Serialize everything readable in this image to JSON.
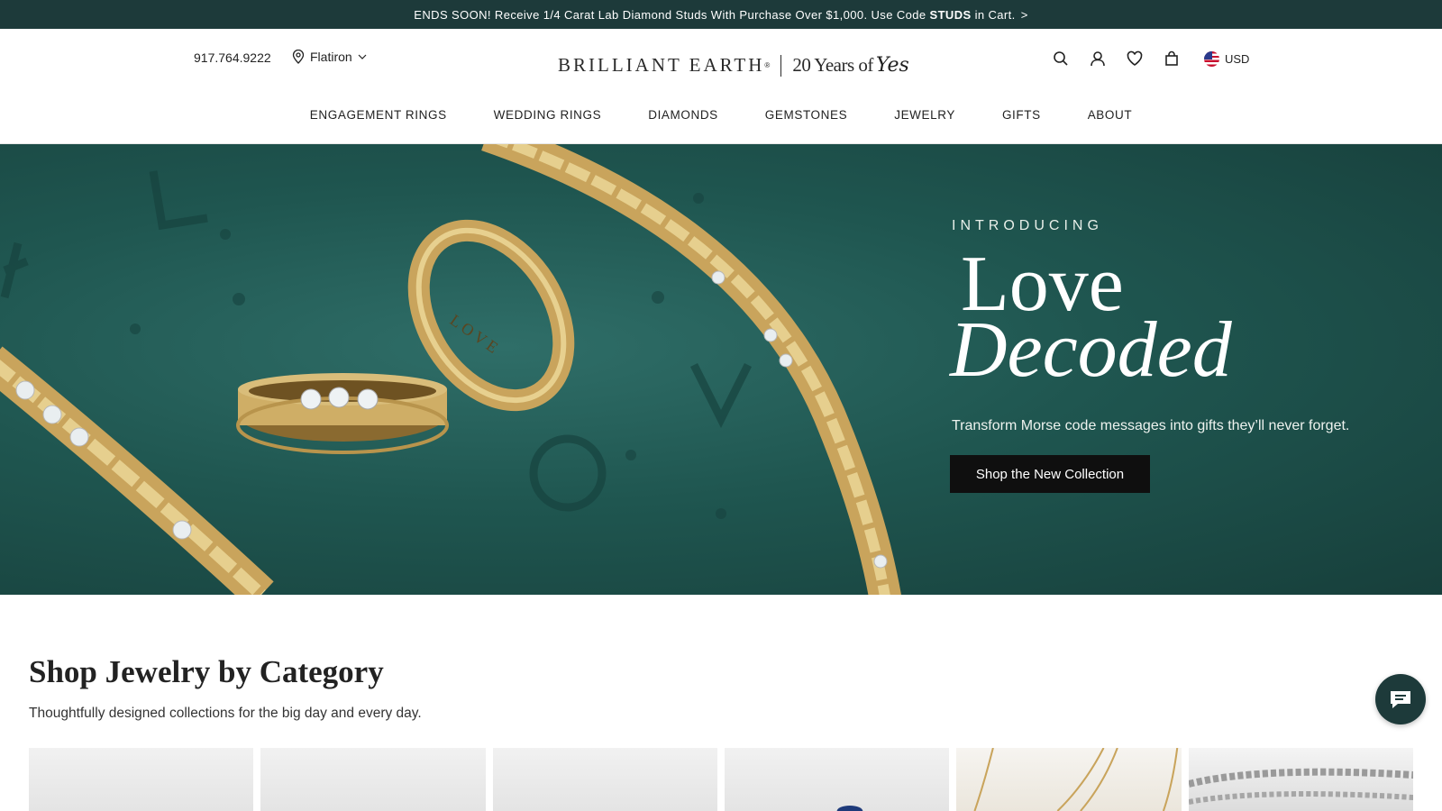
{
  "promo": {
    "text_before": "ENDS SOON! Receive 1/4 Carat Lab Diamond Studs With Purchase Over $1,000. Use Code",
    "code": "STUDS",
    "text_after": "in Cart.",
    "arrow": ">"
  },
  "header": {
    "phone": "917.764.9222",
    "store": "Flatiron",
    "logo_brand": "BRILLIANT EARTH",
    "logo_reg": "®",
    "logo_tagline": "20 Years of",
    "logo_tagline_script": "Yes",
    "currency": "USD",
    "icons": [
      "search-icon",
      "account-icon",
      "wishlist-icon",
      "bag-icon"
    ]
  },
  "nav": {
    "items": [
      "ENGAGEMENT RINGS",
      "WEDDING RINGS",
      "DIAMONDS",
      "GEMSTONES",
      "JEWELRY",
      "GIFTS",
      "ABOUT"
    ]
  },
  "hero": {
    "eyebrow": "INTRODUCING",
    "title_line1": "Love",
    "title_line2": "Decoded",
    "subtitle": "Transform Morse code messages into gifts they’ll never forget.",
    "cta": "Shop the New Collection",
    "ring_engraving": "LOVE"
  },
  "category": {
    "title": "Shop Jewelry by Category",
    "subtitle": "Thoughtfully designed collections for the big day and every day."
  },
  "colors": {
    "promo_bg": "#1d3a3a",
    "hero_bg": "#1f5650",
    "gold": "#c9a45c",
    "cta_bg": "#0f0f0f"
  }
}
